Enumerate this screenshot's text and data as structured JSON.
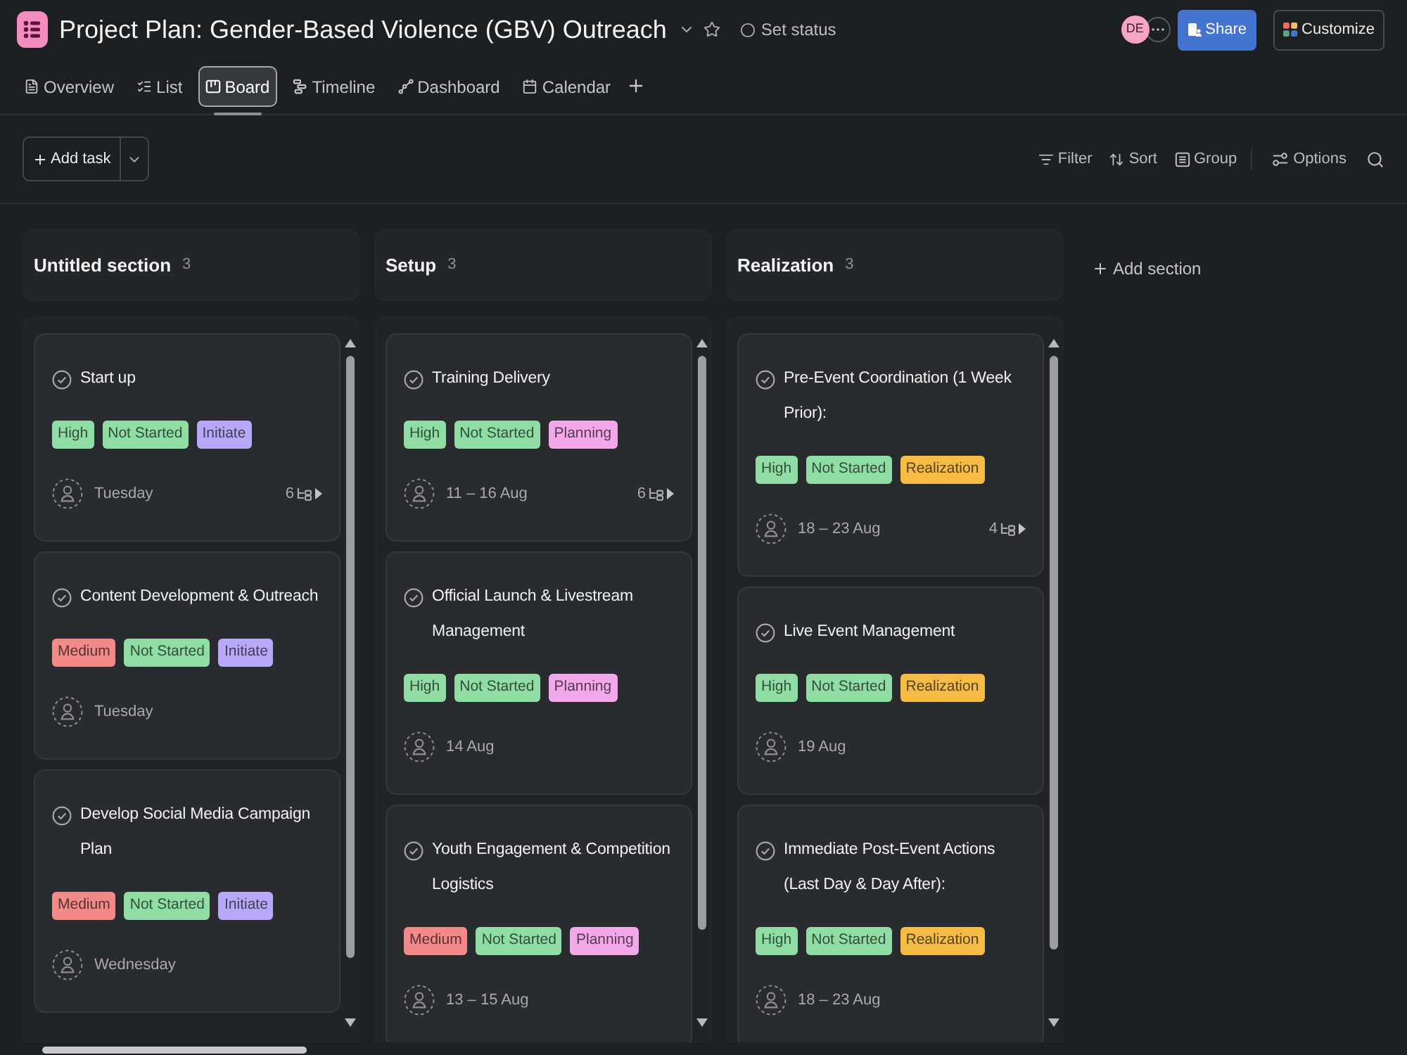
{
  "project": {
    "title": "Project Plan: Gender-Based Violence (GBV) Outreach",
    "status": "Set status"
  },
  "header": {
    "avatar": "DE",
    "share": "Share",
    "customize": "Customize"
  },
  "tabs": [
    {
      "label": "Overview",
      "selected": false
    },
    {
      "label": "List",
      "selected": false
    },
    {
      "label": "Board",
      "selected": true
    },
    {
      "label": "Timeline",
      "selected": false
    },
    {
      "label": "Dashboard",
      "selected": false
    },
    {
      "label": "Calendar",
      "selected": false
    }
  ],
  "toolbar": {
    "add_task": "Add task",
    "actions": [
      "Filter",
      "Sort",
      "Group",
      "Options"
    ]
  },
  "sections": [
    {
      "name": "Untitled section",
      "count": "3",
      "tasks": [
        {
          "title": "Start up",
          "completed": false,
          "tags": [
            {
              "label": "High",
              "color": "#8fdca4"
            },
            {
              "label": "Not Started",
              "color": "#8fdca4"
            },
            {
              "label": "Initiate",
              "color": "#b8a9f8"
            }
          ],
          "due": "Tuesday",
          "subtasks": "6"
        },
        {
          "title": "Content Development & Outreach",
          "completed": false,
          "tags": [
            {
              "label": "Medium",
              "color": "#f48989"
            },
            {
              "label": "Not Started",
              "color": "#8fdca4"
            },
            {
              "label": "Initiate",
              "color": "#b8a9f8"
            }
          ],
          "due": "Tuesday"
        },
        {
          "title": "Develop Social Media Campaign Plan",
          "completed": false,
          "tags": [
            {
              "label": "Medium",
              "color": "#f48989"
            },
            {
              "label": "Not Started",
              "color": "#8fdca4"
            },
            {
              "label": "Initiate",
              "color": "#b8a9f8"
            }
          ],
          "due": "Wednesday"
        }
      ]
    },
    {
      "name": "Setup",
      "count": "3",
      "tasks": [
        {
          "title": "Training Delivery",
          "completed": false,
          "tags": [
            {
              "label": "High",
              "color": "#8fdca4"
            },
            {
              "label": "Not Started",
              "color": "#8fdca4"
            },
            {
              "label": "Planning",
              "color": "#f3a8ea"
            }
          ],
          "due": "11 – 16 Aug",
          "subtasks": "6"
        },
        {
          "title": "Official Launch & Livestream Management",
          "completed": false,
          "tags": [
            {
              "label": "High",
              "color": "#8fdca4"
            },
            {
              "label": "Not Started",
              "color": "#8fdca4"
            },
            {
              "label": "Planning",
              "color": "#f3a8ea"
            }
          ],
          "due": "14 Aug"
        },
        {
          "title": "Youth Engagement & Competition Logistics",
          "completed": false,
          "tags": [
            {
              "label": "Medium",
              "color": "#f48989"
            },
            {
              "label": "Not Started",
              "color": "#8fdca4"
            },
            {
              "label": "Planning",
              "color": "#f3a8ea"
            }
          ],
          "due": "13 – 15 Aug"
        }
      ]
    },
    {
      "name": "Realization",
      "count": "3",
      "tasks": [
        {
          "title": "Pre-Event Coordination (1 Week Prior):",
          "completed": false,
          "tags": [
            {
              "label": "High",
              "color": "#8fdca4"
            },
            {
              "label": "Not Started",
              "color": "#8fdca4"
            },
            {
              "label": "Realization",
              "color": "#f6bb45"
            }
          ],
          "due": "18 – 23 Aug",
          "subtasks": "4"
        },
        {
          "title": "Live Event Management",
          "completed": false,
          "tags": [
            {
              "label": "High",
              "color": "#8fdca4"
            },
            {
              "label": "Not Started",
              "color": "#8fdca4"
            },
            {
              "label": "Realization",
              "color": "#f6bb45"
            }
          ],
          "due": "19 Aug"
        },
        {
          "title": "Immediate Post-Event Actions (Last Day & Day After):",
          "completed": false,
          "tags": [
            {
              "label": "High",
              "color": "#8fdca4"
            },
            {
              "label": "Not Started",
              "color": "#8fdca4"
            },
            {
              "label": "Realization",
              "color": "#f6bb45"
            }
          ],
          "due": "18 – 23 Aug"
        }
      ]
    }
  ],
  "add_section": "Add section"
}
